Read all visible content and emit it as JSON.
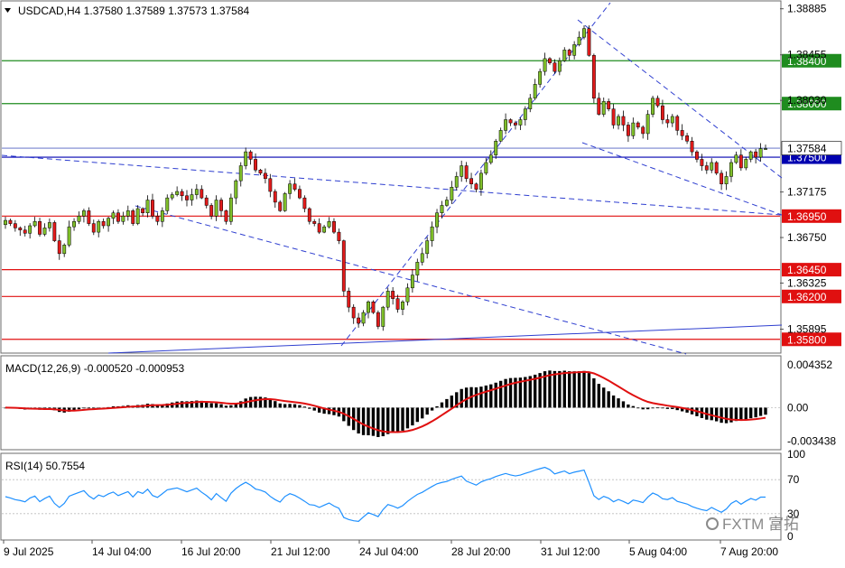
{
  "header": {
    "title": "USDCAD,H4  1.37580 1.37589 1.37573 1.37584",
    "menu_icon": "triangle-down-icon"
  },
  "colors": {
    "bull": "#7fbf2a",
    "bear": "#e11b1b",
    "green_level": "#1f8c1f",
    "red_level": "#e01010",
    "blue_line": "#0000b0",
    "trend": "#2f3fd0",
    "macd_signal": "#e01010",
    "rsi": "#1e90ff",
    "current_price_box": "#1f3fe0"
  },
  "chart_data": [
    {
      "type": "candlestick",
      "name": "price",
      "symbol": "USDCAD",
      "timeframe": "H4",
      "ohlc": [
        1.3758,
        1.37589,
        1.37573,
        1.37584
      ],
      "ylim": [
        1.3568,
        1.3895
      ],
      "y_ticks": [
        "1.38885",
        "1.38455",
        "1.38030",
        "1.37584",
        "1.37500",
        "1.37175",
        "1.36750",
        "1.36325",
        "1.35895"
      ],
      "x_ticks": [
        "9 Jul 2025",
        "14 Jul 04:00",
        "16 Jul 20:00",
        "21 Jul 12:00",
        "24 Jul 04:00",
        "28 Jul 20:00",
        "31 Jul 12:00",
        "5 Aug 04:00",
        "7 Aug 20:00"
      ],
      "horizontal_levels": [
        {
          "value": 1.384,
          "label": "1.38400",
          "kind": "green"
        },
        {
          "value": 1.38,
          "label": "1.38000",
          "kind": "green"
        },
        {
          "value": 1.375,
          "label": "1.37500",
          "kind": "blue"
        },
        {
          "value": 1.3695,
          "label": "1.36950",
          "kind": "red"
        },
        {
          "value": 1.3645,
          "label": "1.36450",
          "kind": "red"
        },
        {
          "value": 1.362,
          "label": "1.36200",
          "kind": "red"
        },
        {
          "value": 1.358,
          "label": "1.35800",
          "kind": "red"
        }
      ],
      "current_price": {
        "value": 1.37584,
        "label": "1.37584"
      },
      "closes": [
        1.3691,
        1.3688,
        1.3684,
        1.3682,
        1.3679,
        1.3686,
        1.369,
        1.3678,
        1.3684,
        1.3689,
        1.3672,
        1.366,
        1.3668,
        1.3685,
        1.369,
        1.3695,
        1.37,
        1.3688,
        1.368,
        1.369,
        1.3686,
        1.3693,
        1.3698,
        1.369,
        1.3695,
        1.37,
        1.3688,
        1.3702,
        1.3698,
        1.371,
        1.3695,
        1.369,
        1.37,
        1.3712,
        1.3715,
        1.3718,
        1.3714,
        1.371,
        1.3715,
        1.372,
        1.3712,
        1.3705,
        1.3695,
        1.371,
        1.37,
        1.369,
        1.3712,
        1.3728,
        1.3742,
        1.3755,
        1.3748,
        1.3738,
        1.3735,
        1.373,
        1.3718,
        1.3708,
        1.37,
        1.3716,
        1.3725,
        1.372,
        1.3712,
        1.3702,
        1.369,
        1.3688,
        1.368,
        1.3685,
        1.369,
        1.368,
        1.3672,
        1.3625,
        1.361,
        1.36,
        1.3595,
        1.3605,
        1.3615,
        1.3605,
        1.3592,
        1.361,
        1.3625,
        1.3618,
        1.3608,
        1.3615,
        1.3628,
        1.364,
        1.3652,
        1.366,
        1.3672,
        1.3685,
        1.3698,
        1.3705,
        1.371,
        1.3722,
        1.3732,
        1.3742,
        1.373,
        1.3725,
        1.372,
        1.3735,
        1.3745,
        1.3752,
        1.3765,
        1.3775,
        1.3785,
        1.3782,
        1.378,
        1.3785,
        1.3795,
        1.3805,
        1.3818,
        1.383,
        1.3842,
        1.3838,
        1.383,
        1.384,
        1.385,
        1.3845,
        1.3855,
        1.3862,
        1.387,
        1.3845,
        1.3805,
        1.379,
        1.3802,
        1.3795,
        1.378,
        1.3788,
        1.378,
        1.377,
        1.3782,
        1.3778,
        1.3772,
        1.379,
        1.3805,
        1.3798,
        1.3785,
        1.3782,
        1.3788,
        1.3775,
        1.377,
        1.3765,
        1.3755,
        1.3748,
        1.3742,
        1.3738,
        1.3745,
        1.3735,
        1.3725,
        1.3732,
        1.3745,
        1.3752,
        1.374,
        1.3748,
        1.3755,
        1.375,
        1.3758,
        1.3758
      ],
      "trendlines": "dashed channel lines and support line"
    },
    {
      "type": "histogram+line",
      "name": "MACD",
      "title": "MACD(12,26,9) -0.000520 -0.000953",
      "y_ticks": [
        "0.004352",
        "0.00",
        "-0.003438"
      ],
      "ylim": [
        -0.0042,
        0.0052
      ]
    },
    {
      "type": "line",
      "name": "RSI",
      "title": "RSI(14) 50.7554",
      "y_ticks": [
        "100",
        "70",
        "30",
        "0"
      ],
      "ylim": [
        0,
        100
      ]
    }
  ],
  "macd_title": "MACD(12,26,9) -0.000520 -0.000953",
  "rsi_title": "RSI(14) 50.7554",
  "watermark": "FXTM 富拓"
}
